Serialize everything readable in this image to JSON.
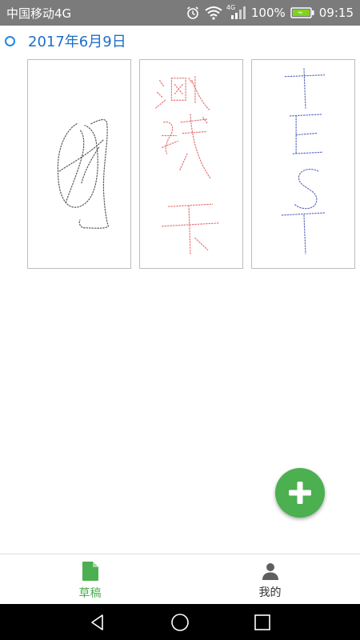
{
  "status_bar": {
    "carrier": "中国移动4G",
    "network_tag": "4G",
    "battery": "100%",
    "time": "09:15"
  },
  "date_group": {
    "label": "2017年6月9日"
  },
  "drafts": [
    {
      "stroke_color": "#555555"
    },
    {
      "stroke_color": "#e57373"
    },
    {
      "stroke_color": "#5c6bc0"
    }
  ],
  "fab": {
    "icon": "plus-icon",
    "color": "#4caf50"
  },
  "bottom_nav": {
    "items": [
      {
        "label": "草稿",
        "icon": "document-icon",
        "active": true
      },
      {
        "label": "我的",
        "icon": "person-icon",
        "active": false
      }
    ],
    "active_color": "#4caf50"
  },
  "system_nav": {
    "buttons": [
      "back-icon",
      "home-icon",
      "recents-icon"
    ]
  }
}
